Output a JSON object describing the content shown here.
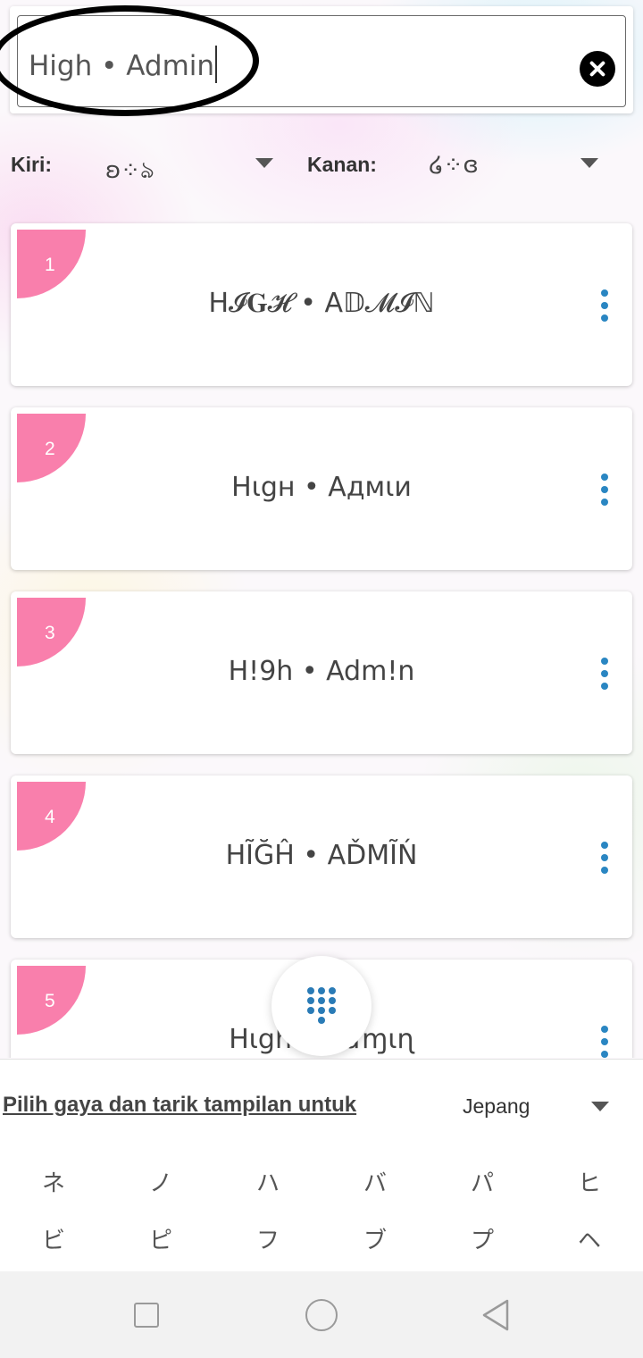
{
  "input": {
    "value": "High • Admin"
  },
  "decorations": {
    "left": {
      "label": "Kiri:",
      "value": "ʚ⁘ঌ"
    },
    "right": {
      "label": "Kanan:",
      "value": "໒⁘ɞ"
    }
  },
  "results": [
    {
      "number": "1",
      "text": "H𝓘𝐆𝓗 • A𝔻𝓜𝓘ℕ"
    },
    {
      "number": "2",
      "text": "Hιgн • Aдмιи"
    },
    {
      "number": "3",
      "text": "H!9h • Adm!n"
    },
    {
      "number": "4",
      "text": "HĨĞĤ • AĎMĨŃ"
    },
    {
      "number": "5",
      "text": "Hιgh • Aɗɱιɳ"
    }
  ],
  "panel": {
    "instruction": "Pilih gaya dan tarik tampilan untuk",
    "language": "Jepang",
    "kana_row1": [
      "ネ",
      "ノ",
      "ハ",
      "バ",
      "パ",
      "ヒ"
    ],
    "kana_row2": [
      "ビ",
      "ピ",
      "フ",
      "ブ",
      "プ",
      "ヘ"
    ]
  },
  "colors": {
    "badge": "#f97fac",
    "accent": "#2a86c2"
  }
}
